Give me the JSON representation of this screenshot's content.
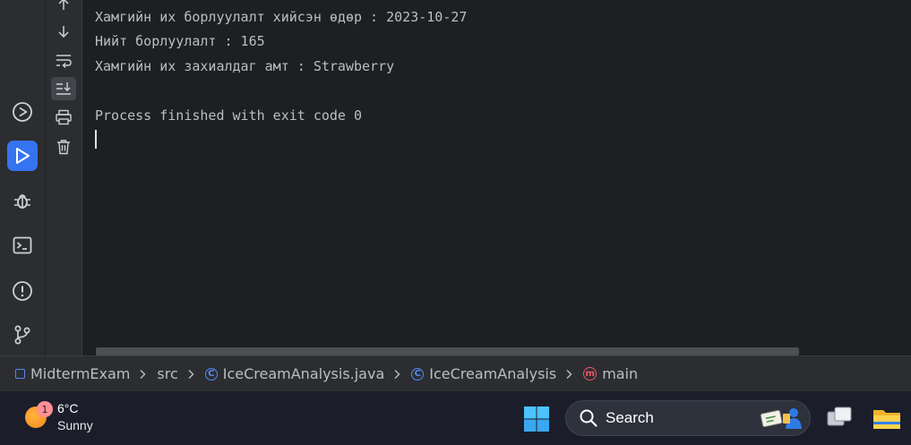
{
  "console": {
    "lines": [
      "Хамгийн их борлуулалт хийсэн өдөр : 2023-10-27",
      "Нийт борлуулалт : 165",
      "Хамгийн их захиалдаг амт : Strawberry",
      "",
      "Process finished with exit code 0"
    ]
  },
  "breadcrumb": {
    "project": "MidtermExam",
    "folder": "src",
    "file": "IceCreamAnalysis.java",
    "class": "IceCreamAnalysis",
    "method": "main",
    "class_icon_letter": "C",
    "method_icon_letter": "m"
  },
  "taskbar": {
    "weather_temp": "6°C",
    "weather_condition": "Sunny",
    "weather_badge": "1",
    "search_label": "Search"
  },
  "colors": {
    "accent": "#3574f0",
    "console_text": "#bcbec4",
    "class_icon": "#548af7",
    "method_icon": "#f75464"
  },
  "icons": {
    "left_stripe": [
      "services-icon",
      "run-icon",
      "debug-icon",
      "terminal-icon",
      "problems-icon",
      "git-icon"
    ],
    "run_toolbar": [
      "scroll-up-icon",
      "scroll-down-icon",
      "soft-wrap-icon",
      "scroll-to-end-icon",
      "print-icon",
      "clear-all-icon"
    ]
  }
}
